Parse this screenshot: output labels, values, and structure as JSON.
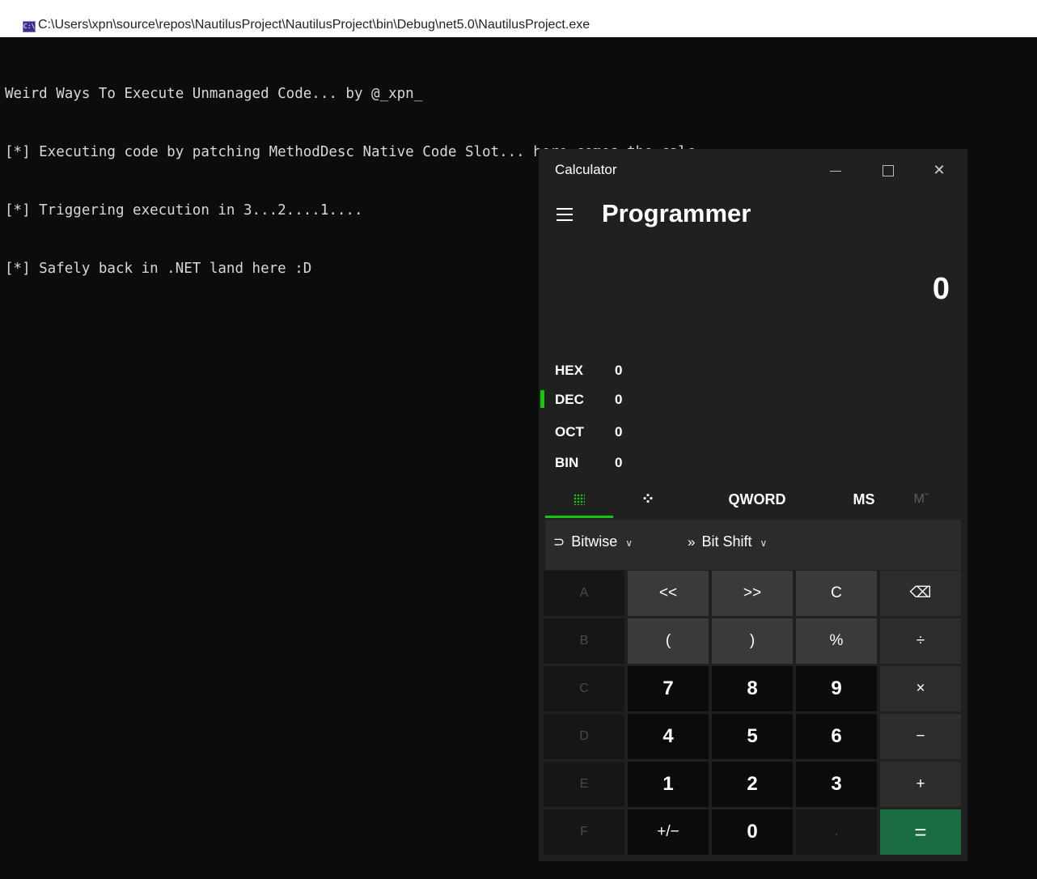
{
  "console": {
    "title": "C:\\Users\\xpn\\source\\repos\\NautilusProject\\NautilusProject\\bin\\Debug\\net5.0\\NautilusProject.exe",
    "icon_label": "C:\\",
    "lines": [
      "Weird Ways To Execute Unmanaged Code... by @_xpn_",
      "[*] Executing code by patching MethodDesc Native Code Slot... here comes the calc",
      "[*] Triggering execution in 3...2....1....",
      "[*] Safely back in .NET land here :D"
    ]
  },
  "calculator": {
    "window_title": "Calculator",
    "controls": {
      "minimize": "",
      "maximize": "",
      "close": "✕"
    },
    "mode": "Programmer",
    "display": "0",
    "bases": [
      {
        "label": "HEX",
        "value": "0"
      },
      {
        "label": "DEC",
        "value": "0",
        "selected": true
      },
      {
        "label": "OCT",
        "value": "0"
      },
      {
        "label": "BIN",
        "value": "0"
      }
    ],
    "tabs": {
      "bits": "⁘",
      "word_size": "QWORD",
      "memory_store": "MS",
      "memory": "Mˇ"
    },
    "ops": {
      "bitwise": "Bitwise",
      "bitshift": "Bit Shift",
      "bitshift_icon": "»",
      "bitwise_icon": "⊃",
      "chevron": "∨"
    },
    "keys": [
      [
        "A",
        "<<",
        ">>",
        "C",
        "⌫"
      ],
      [
        "B",
        "(",
        ")",
        "%",
        "÷"
      ],
      [
        "C",
        "7",
        "8",
        "9",
        "×"
      ],
      [
        "D",
        "4",
        "5",
        "6",
        "−"
      ],
      [
        "E",
        "1",
        "2",
        "3",
        "+"
      ],
      [
        "F",
        "+/−",
        "0",
        ".",
        "="
      ]
    ],
    "accent_color": "#16c60c",
    "equals_color": "#1a6b3f"
  }
}
